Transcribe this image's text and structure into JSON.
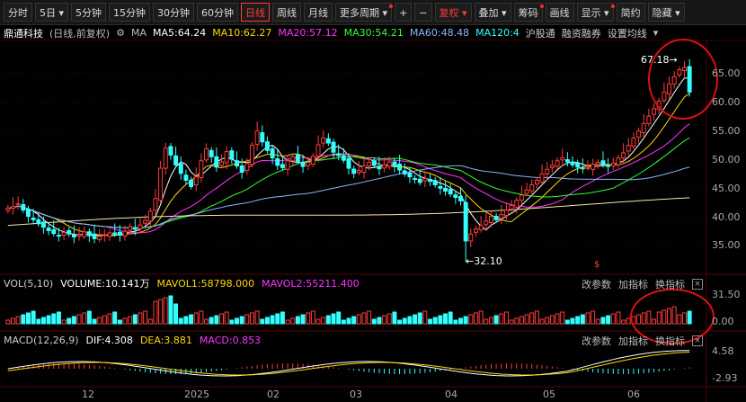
{
  "toolbar": {
    "items": [
      {
        "label": "分时"
      },
      {
        "label": "5日",
        "dropdown": true
      },
      {
        "label": "5分钟"
      },
      {
        "label": "15分钟"
      },
      {
        "label": "30分钟"
      },
      {
        "label": "60分钟"
      },
      {
        "label": "日线",
        "active": true
      },
      {
        "label": "周线"
      },
      {
        "label": "月线"
      },
      {
        "label": "更多周期",
        "dropdown": true,
        "dot": true
      }
    ],
    "plus": "+",
    "minus": "−",
    "fuquan": "复权",
    "diejia": "叠加",
    "choumayu": "筹码",
    "huaxian": "画线",
    "xianshi": "显示",
    "jianyue": "简约",
    "yincang": "隐藏",
    "icons": [
      "plus-icon",
      "minus-icon",
      "restore-icon",
      "overlay-icon",
      "chips-icon",
      "draw-icon",
      "display-icon",
      "simple-icon",
      "hide-icon"
    ]
  },
  "legend": {
    "name": "鼎通科技",
    "sub": "(日线,前复权)",
    "ma": "MA",
    "ma5": "MA5:64.24",
    "ma10": "MA10:62.27",
    "ma20": "MA20:57.12",
    "ma30": "MA30:54.21",
    "ma60": "MA60:48.48",
    "ma120": "MA120:4",
    "btn1": "沪股通",
    "btn2": "融资融券",
    "btn3": "设置均线",
    "colors": {
      "ma5": "#ffffff",
      "ma10": "#ffd700",
      "ma20": "#ff33ff",
      "ma30": "#33ff33",
      "ma60": "#8ab4ff",
      "ma120": "#33ffff",
      "up": "#ff3b3b",
      "down": "#33ffff"
    }
  },
  "main_axis": {
    "ticks": [
      "65.00",
      "60.00",
      "55.00",
      "50.00",
      "45.00",
      "40.00",
      "35.00"
    ]
  },
  "annotations": {
    "high": "67.18",
    "low": "32.10",
    "arrow_left": "←",
    "arrow_right": "→"
  },
  "vol": {
    "title": "VOL(5,10)",
    "volume": "VOLUME:10.141万",
    "mavol1": "MAVOL1:58798.000",
    "mavol2": "MAVOL2:55211.400",
    "ticks": [
      "31.50",
      "0.00"
    ],
    "btn1": "改参数",
    "btn2": "加指标",
    "btn3": "换指标",
    "close": "×"
  },
  "macd": {
    "title": "MACD(12,26,9)",
    "dif": "DIF:4.308",
    "dea": "DEA:3.881",
    "macdv": "MACD:0.853",
    "ticks": [
      "4.58",
      "-2.93"
    ],
    "btn1": "改参数",
    "btn2": "加指标",
    "btn3": "换指标",
    "close": "×"
  },
  "xaxis": {
    "labels": [
      "12",
      "2025",
      "02",
      "03",
      "04",
      "05",
      "06"
    ]
  },
  "chart_data": {
    "type": "candlestick",
    "ylim": [
      32.1,
      67.18
    ],
    "x_labels": [
      "12",
      "2025",
      "02",
      "03",
      "04",
      "05",
      "06"
    ],
    "closes": [
      41.5,
      41.8,
      42.3,
      41.2,
      40.1,
      39.5,
      38.8,
      38.2,
      37.6,
      37.1,
      36.8,
      37.3,
      37.0,
      36.5,
      36.9,
      37.4,
      36.7,
      36.2,
      36.6,
      36.9,
      37.2,
      37.0,
      36.8,
      37.5,
      38.3,
      37.9,
      38.6,
      39.4,
      41.0,
      43.2,
      48.5,
      52.0,
      50.8,
      49.1,
      47.6,
      46.4,
      45.3,
      47.0,
      49.8,
      51.9,
      50.5,
      48.7,
      49.6,
      51.4,
      50.1,
      48.9,
      47.8,
      49.3,
      52.5,
      55.0,
      53.1,
      51.6,
      50.3,
      49.0,
      48.6,
      49.8,
      50.5,
      49.7,
      48.8,
      49.5,
      50.6,
      52.6,
      53.8,
      52.9,
      51.3,
      50.7,
      49.9,
      48.5,
      47.6,
      48.1,
      48.9,
      49.5,
      49.0,
      48.4,
      49.1,
      49.6,
      48.9,
      48.2,
      47.5,
      47.0,
      46.6,
      46.0,
      46.7,
      46.2,
      45.6,
      45.0,
      44.5,
      44.0,
      43.4,
      42.8,
      35.8,
      37.0,
      37.9,
      38.5,
      39.3,
      40.1,
      39.5,
      40.4,
      41.2,
      42.0,
      42.9,
      43.8,
      44.7,
      45.6,
      46.4,
      47.5,
      48.3,
      49.0,
      49.8,
      50.3,
      49.6,
      49.1,
      48.7,
      48.4,
      48.6,
      49.2,
      49.5,
      49.1,
      48.8,
      49.4,
      50.3,
      51.2,
      52.5,
      53.8,
      55.0,
      56.3,
      57.6,
      58.9,
      60.2,
      61.8,
      63.2,
      64.5,
      65.7,
      66.1,
      61.8
    ]
  }
}
